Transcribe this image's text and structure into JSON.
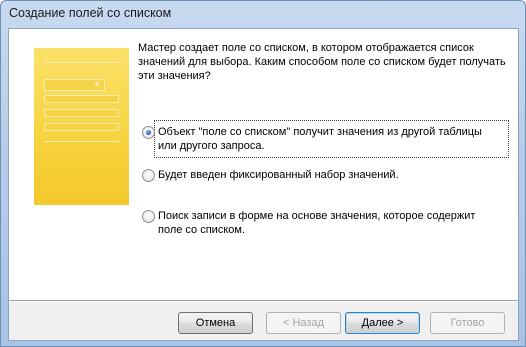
{
  "window": {
    "title": "Создание полей со списком"
  },
  "wizard": {
    "description": "Мастер создает поле со списком, в котором отображается список значений для выбора.  Каким способом поле со списком будет получать эти значения?",
    "options": [
      {
        "label": "Объект \"поле со списком\" получит значения из другой таблицы или другого запроса.",
        "selected": true
      },
      {
        "label": "Будет введен фиксированный набор значений.",
        "selected": false
      },
      {
        "label": "Поиск записи в форме на основе значения, которое содержит поле со списком.",
        "selected": false
      }
    ]
  },
  "buttons": {
    "cancel": "Отмена",
    "back": "< Назад",
    "next": "Далее >",
    "finish": "Готово"
  }
}
